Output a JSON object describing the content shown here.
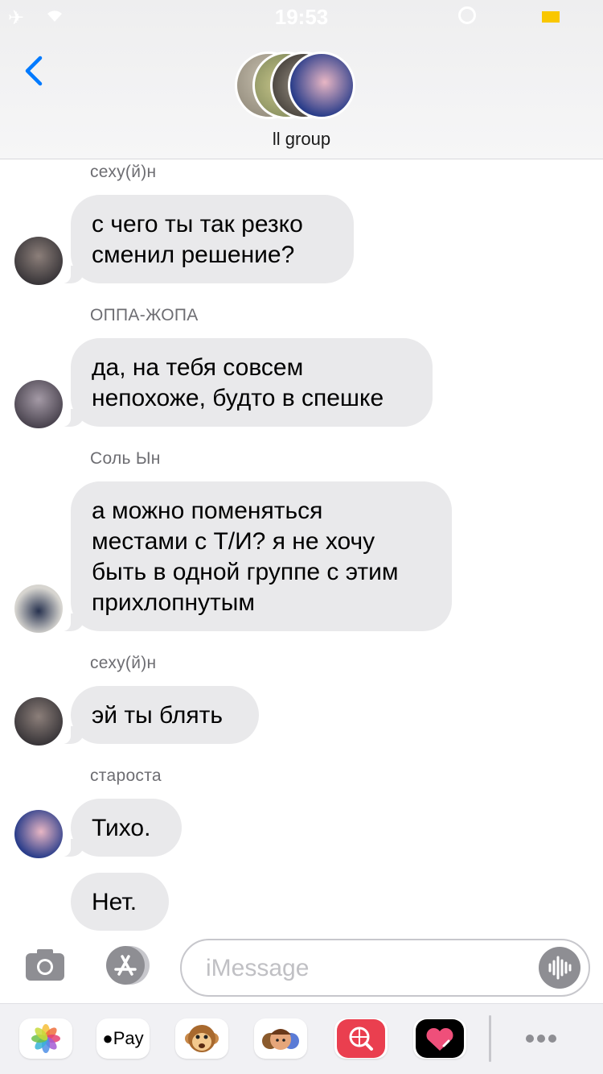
{
  "status_bar": {
    "time": "19:53"
  },
  "header": {
    "group_name": "ll group"
  },
  "messages": [
    {
      "sender": "сеху(й)н",
      "lines": [
        "с чего ты так резко",
        "сменил решение?"
      ]
    },
    {
      "sender": "ОППА-ЖОПА",
      "lines": [
        "да, на тебя совсем",
        "непохоже, будто в спешке"
      ]
    },
    {
      "sender": "Соль Ын",
      "lines": [
        "а можно поменяться",
        "местами с Т/И? я не хочу",
        "быть в одной группе с этим",
        "прихлопнутым"
      ]
    },
    {
      "sender": "сеху(й)н",
      "lines": [
        "эй ты блять"
      ]
    },
    {
      "sender": "староста",
      "lines": [
        "Тихо."
      ]
    },
    {
      "sender": "",
      "lines": [
        "Нет."
      ]
    }
  ],
  "composer": {
    "placeholder": "iMessage"
  },
  "app_drawer": {
    "apple_pay_label": "Pay",
    "apps": [
      "photos-app",
      "apple-pay-app",
      "animoji-app",
      "memoji-app",
      "web-search-app",
      "digital-touch-app"
    ]
  },
  "colors": {
    "accent": "#007aff",
    "bubble": "#e9e9eb",
    "sender_text": "#6d6d72"
  }
}
